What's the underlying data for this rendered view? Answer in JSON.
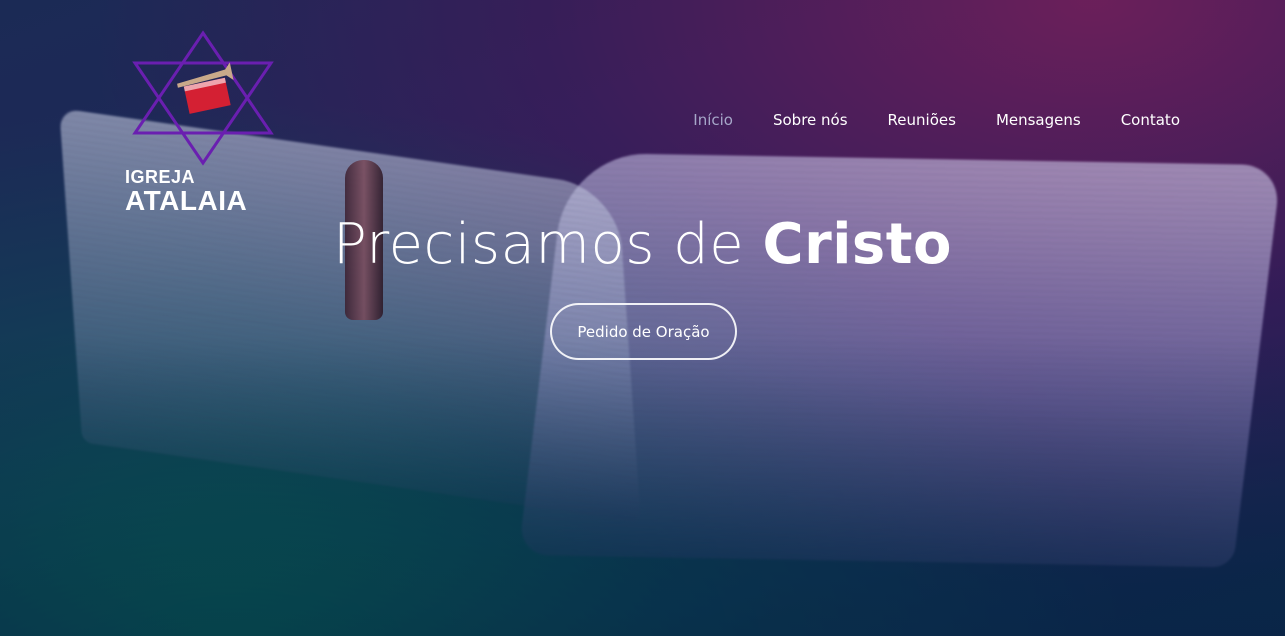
{
  "brand": {
    "line1": "IGREJA",
    "line2": "ATALAIA",
    "logo_icon": "star-of-david-trumpet-icon",
    "colors": {
      "star": "#6a1fb0",
      "banner": "#d42033"
    }
  },
  "nav": {
    "items": [
      {
        "label": "Início",
        "active": true
      },
      {
        "label": "Sobre nós",
        "active": false
      },
      {
        "label": "Reuniões",
        "active": false
      },
      {
        "label": "Mensagens",
        "active": false
      },
      {
        "label": "Contato",
        "active": false
      }
    ]
  },
  "hero": {
    "title_light": "Precisamos de",
    "title_bold": "Cristo",
    "cta_label": "Pedido de Oração",
    "background": "open-bible-with-pen"
  }
}
